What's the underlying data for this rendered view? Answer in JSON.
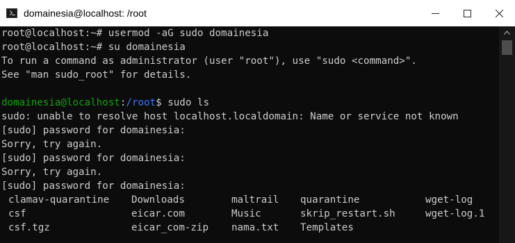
{
  "window": {
    "title": "domainesia@localhost: /root",
    "icon": "console-app-icon",
    "controls": [
      "minimize-icon",
      "maximize-icon",
      "close-icon"
    ]
  },
  "terminal": {
    "lines": [
      "root@localhost:~# usermod -aG sudo domainesia",
      "root@localhost:~# su domainesia",
      "To run a command as administrator (user \"root\"), use \"sudo <command>\".",
      "See \"man sudo_root\" for details.",
      ""
    ],
    "prompt": {
      "user_host": "domainesia@localhost",
      "sep": ":",
      "path": "/root",
      "symbol": "$",
      "command": " sudo ls"
    },
    "output": [
      "sudo: unable to resolve host localhost.localdomain: Name or service not known",
      "[sudo] password for domainesia:",
      "Sorry, try again.",
      "[sudo] password for domainesia:",
      "Sorry, try again.",
      "[sudo] password for domainesia:"
    ],
    "ls_rows": [
      [
        "clamav-quarantine",
        "Downloads",
        "maltrail",
        "quarantine",
        "wget-log"
      ],
      [
        "csf",
        "eicar.com",
        "Music",
        "skrip_restart.sh",
        "wget-log.1"
      ],
      [
        "csf.tgz",
        "eicar_com-zip",
        "nama.txt",
        "Templates",
        ""
      ]
    ]
  },
  "colors": {
    "background": "#0c0c0c",
    "text": "#cccccc",
    "prompt_user": "#13a10e",
    "prompt_path": "#3b78ff"
  }
}
